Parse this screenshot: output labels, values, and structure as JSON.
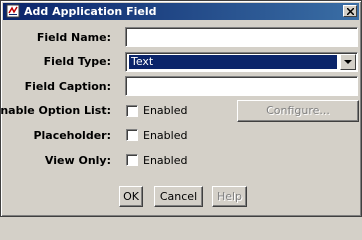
{
  "window": {
    "title": "Add Application Field",
    "icon": "app-field-icon",
    "close_icon": "close-icon"
  },
  "form": {
    "field_name": {
      "label": "Field Name:",
      "value": ""
    },
    "field_type": {
      "label": "Field Type:",
      "selected": "Text"
    },
    "field_caption": {
      "label": "Field Caption:",
      "value": ""
    },
    "enable_option_list": {
      "label": "Enable Option List:",
      "checkbox_label": "Enabled",
      "checked": false,
      "configure_label": "Configure..."
    },
    "placeholder": {
      "label": "Placeholder:",
      "checkbox_label": "Enabled",
      "checked": false
    },
    "view_only": {
      "label": "View Only:",
      "checkbox_label": "Enabled",
      "checked": false
    }
  },
  "buttons": {
    "ok": "OK",
    "cancel": "Cancel",
    "help": "Help"
  },
  "colors": {
    "title_start": "#0a246a",
    "title_end": "#3a6ea5",
    "face": "#d4d0c8",
    "selection": "#0a246a"
  }
}
